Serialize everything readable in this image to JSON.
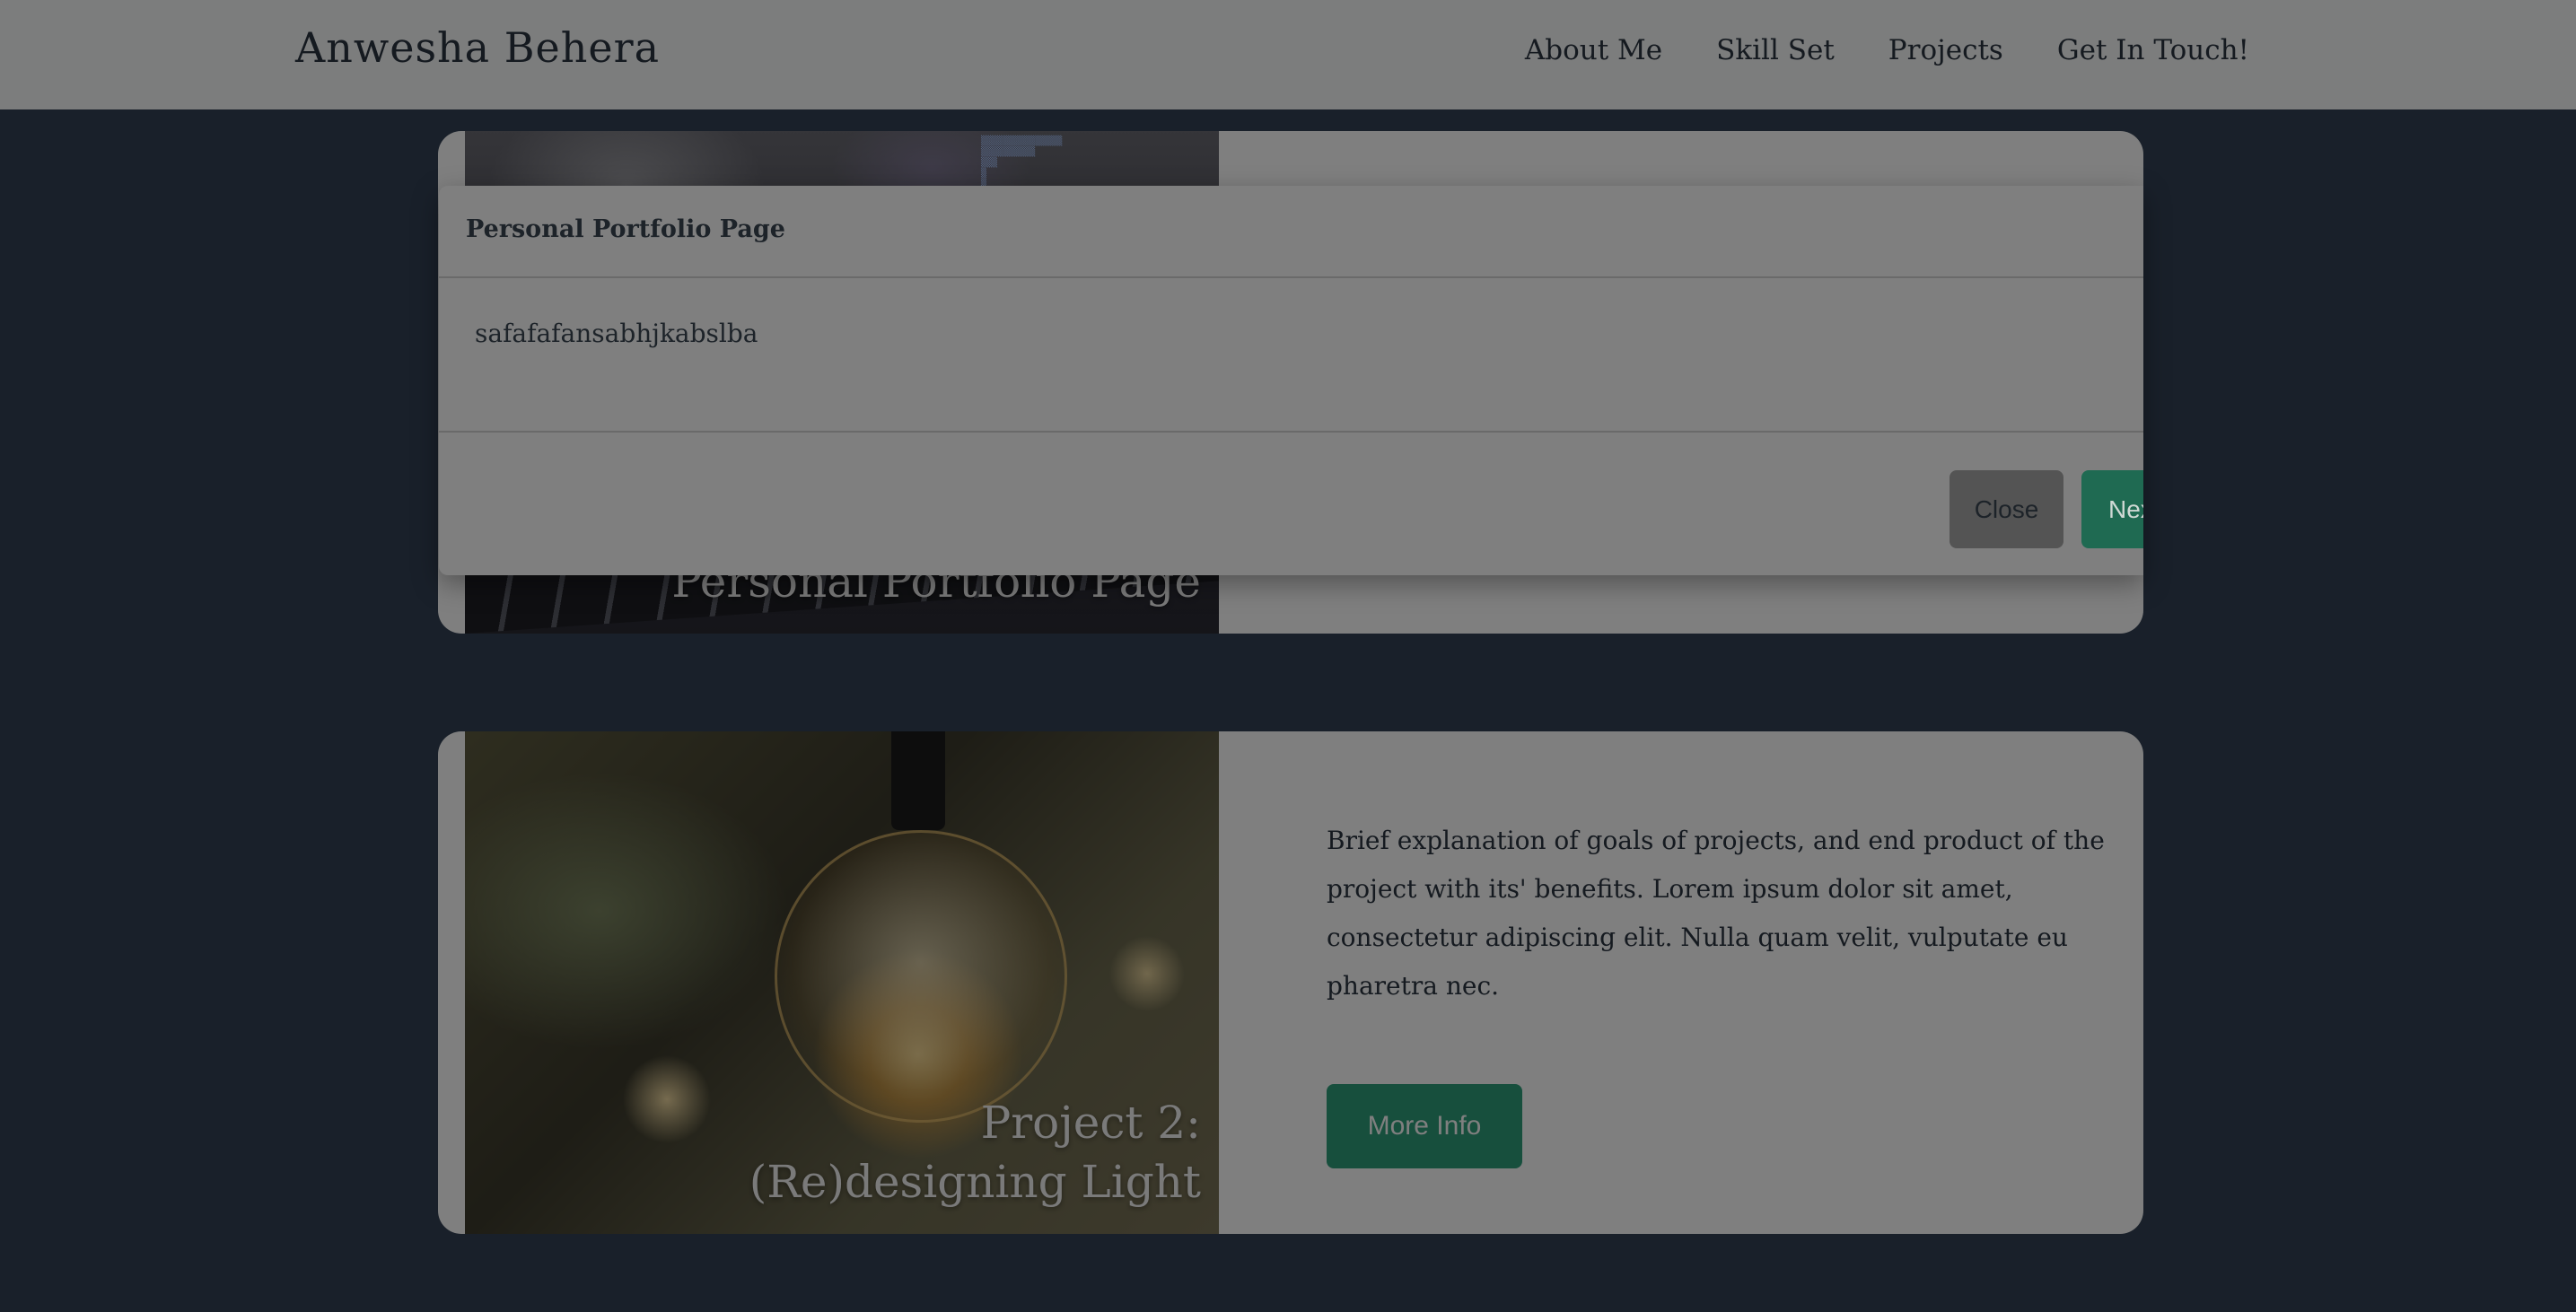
{
  "navbar": {
    "brand": "Anwesha Behera",
    "links": [
      "About Me",
      "Skill Set",
      "Projects",
      "Get In Touch!"
    ]
  },
  "projects": [
    {
      "title_line1": "Personal Portfolio Page",
      "title_line2": ""
    },
    {
      "title_line1": "Project 2:",
      "title_line2": "(Re)designing Light",
      "description": "Brief explanation of goals of projects, and end product of the project with its' benefits. Lorem ipsum dolor sit amet, consectetur adipiscing elit. Nulla quam velit, vulputate eu pharetra nec.",
      "button_label": "More Info"
    }
  ],
  "modal": {
    "title": "Personal Portfolio Page",
    "body": "safafafansabhjkabslba",
    "close_label": "Close",
    "next_label": "Next"
  }
}
